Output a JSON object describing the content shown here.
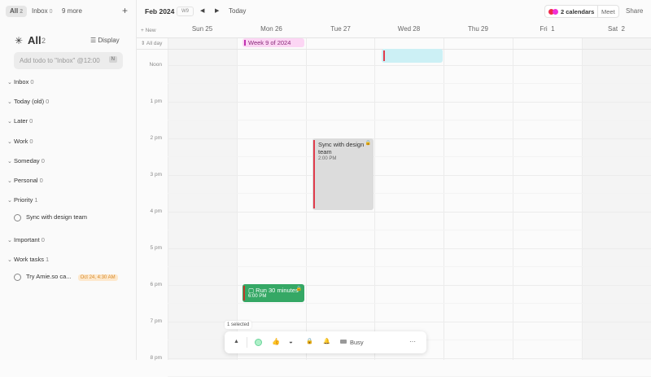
{
  "sidebar": {
    "tabs": [
      {
        "label": "All",
        "count": "2"
      },
      {
        "label": "Inbox",
        "count": "0"
      },
      {
        "label": "9 more"
      }
    ],
    "add": "+",
    "title": "All",
    "title_count": "2",
    "display": "Display",
    "input_placeholder": "Add todo to \"Inbox\" @12:00",
    "shortcut": "N",
    "groups": [
      {
        "label": "Inbox",
        "count": "0"
      },
      {
        "label": "Today (old)",
        "count": "0"
      },
      {
        "label": "Later",
        "count": "0"
      },
      {
        "label": "Work",
        "count": "0"
      },
      {
        "label": "Someday",
        "count": "0"
      },
      {
        "label": "Personal",
        "count": "0"
      },
      {
        "label": "Priority",
        "count": "1"
      },
      {
        "label": "Important",
        "count": "0"
      },
      {
        "label": "Work tasks",
        "count": "1"
      }
    ],
    "todos": [
      {
        "label": "Sync with design team"
      },
      {
        "label": "Try Amie.so ca...",
        "badge": "Oct 24, 4:30 AM"
      }
    ]
  },
  "header": {
    "month": "Feb 2024",
    "week": "W9",
    "today": "Today",
    "calendars": "2 calendars",
    "meet": "Meet",
    "share": "Share",
    "new": "New",
    "allday": "All day"
  },
  "days": [
    "Sun 25",
    "Mon 26",
    "Tue 27",
    "Wed 28",
    "Thu 29",
    "Fri  1",
    "Sat  2"
  ],
  "hours": [
    "Noon",
    "1 pm",
    "2 pm",
    "3 pm",
    "4 pm",
    "5 pm",
    "6 pm",
    "7 pm",
    "8 pm"
  ],
  "events": {
    "allday": "Week 9 of 2024",
    "sync": {
      "title": "Sync with design team",
      "time": "2:00 PM"
    },
    "run": {
      "title": "Run 30 minutes",
      "time": "6:00 PM"
    }
  },
  "toolbar": {
    "selected": "1 selected",
    "busy": "Busy",
    "more": "···"
  },
  "colors": {
    "accent": "#e03c4c",
    "green": "#35a865",
    "cyan": "#ccf0f5",
    "pink": "#fcd6f4"
  }
}
